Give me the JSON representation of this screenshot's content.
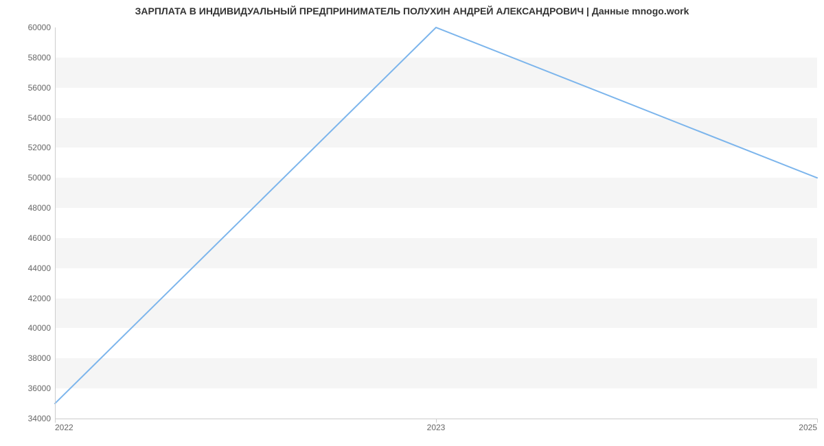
{
  "title": "ЗАРПЛАТА В ИНДИВИДУАЛЬНЫЙ ПРЕДПРИНИМАТЕЛЬ ПОЛУХИН АНДРЕЙ АЛЕКСАНДРОВИЧ | Данные mnogo.work",
  "colors": {
    "line": "#7cb5ec",
    "band": "#f5f5f5",
    "axis": "#cccccc",
    "text": "#333333",
    "tick_text": "#666666"
  },
  "y_ticks": [
    "34000",
    "36000",
    "38000",
    "40000",
    "42000",
    "44000",
    "46000",
    "48000",
    "50000",
    "52000",
    "54000",
    "56000",
    "58000",
    "60000"
  ],
  "x_ticks": [
    {
      "label": "2022",
      "frac": 0.0
    },
    {
      "label": "2023",
      "frac": 0.5
    },
    {
      "label": "2025",
      "frac": 1.0
    }
  ],
  "chart_data": {
    "type": "line",
    "title": "ЗАРПЛАТА В ИНДИВИДУАЛЬНЫЙ ПРЕДПРИНИМАТЕЛЬ ПОЛУХИН АНДРЕЙ АЛЕКСАНДРОВИЧ | Данные mnogo.work",
    "xlabel": "",
    "ylabel": "",
    "categories": [
      "2022",
      "2023",
      "2025"
    ],
    "values": [
      35000,
      60000,
      50000
    ],
    "ylim": [
      34000,
      60000
    ],
    "grid": "horizontal-bands"
  }
}
